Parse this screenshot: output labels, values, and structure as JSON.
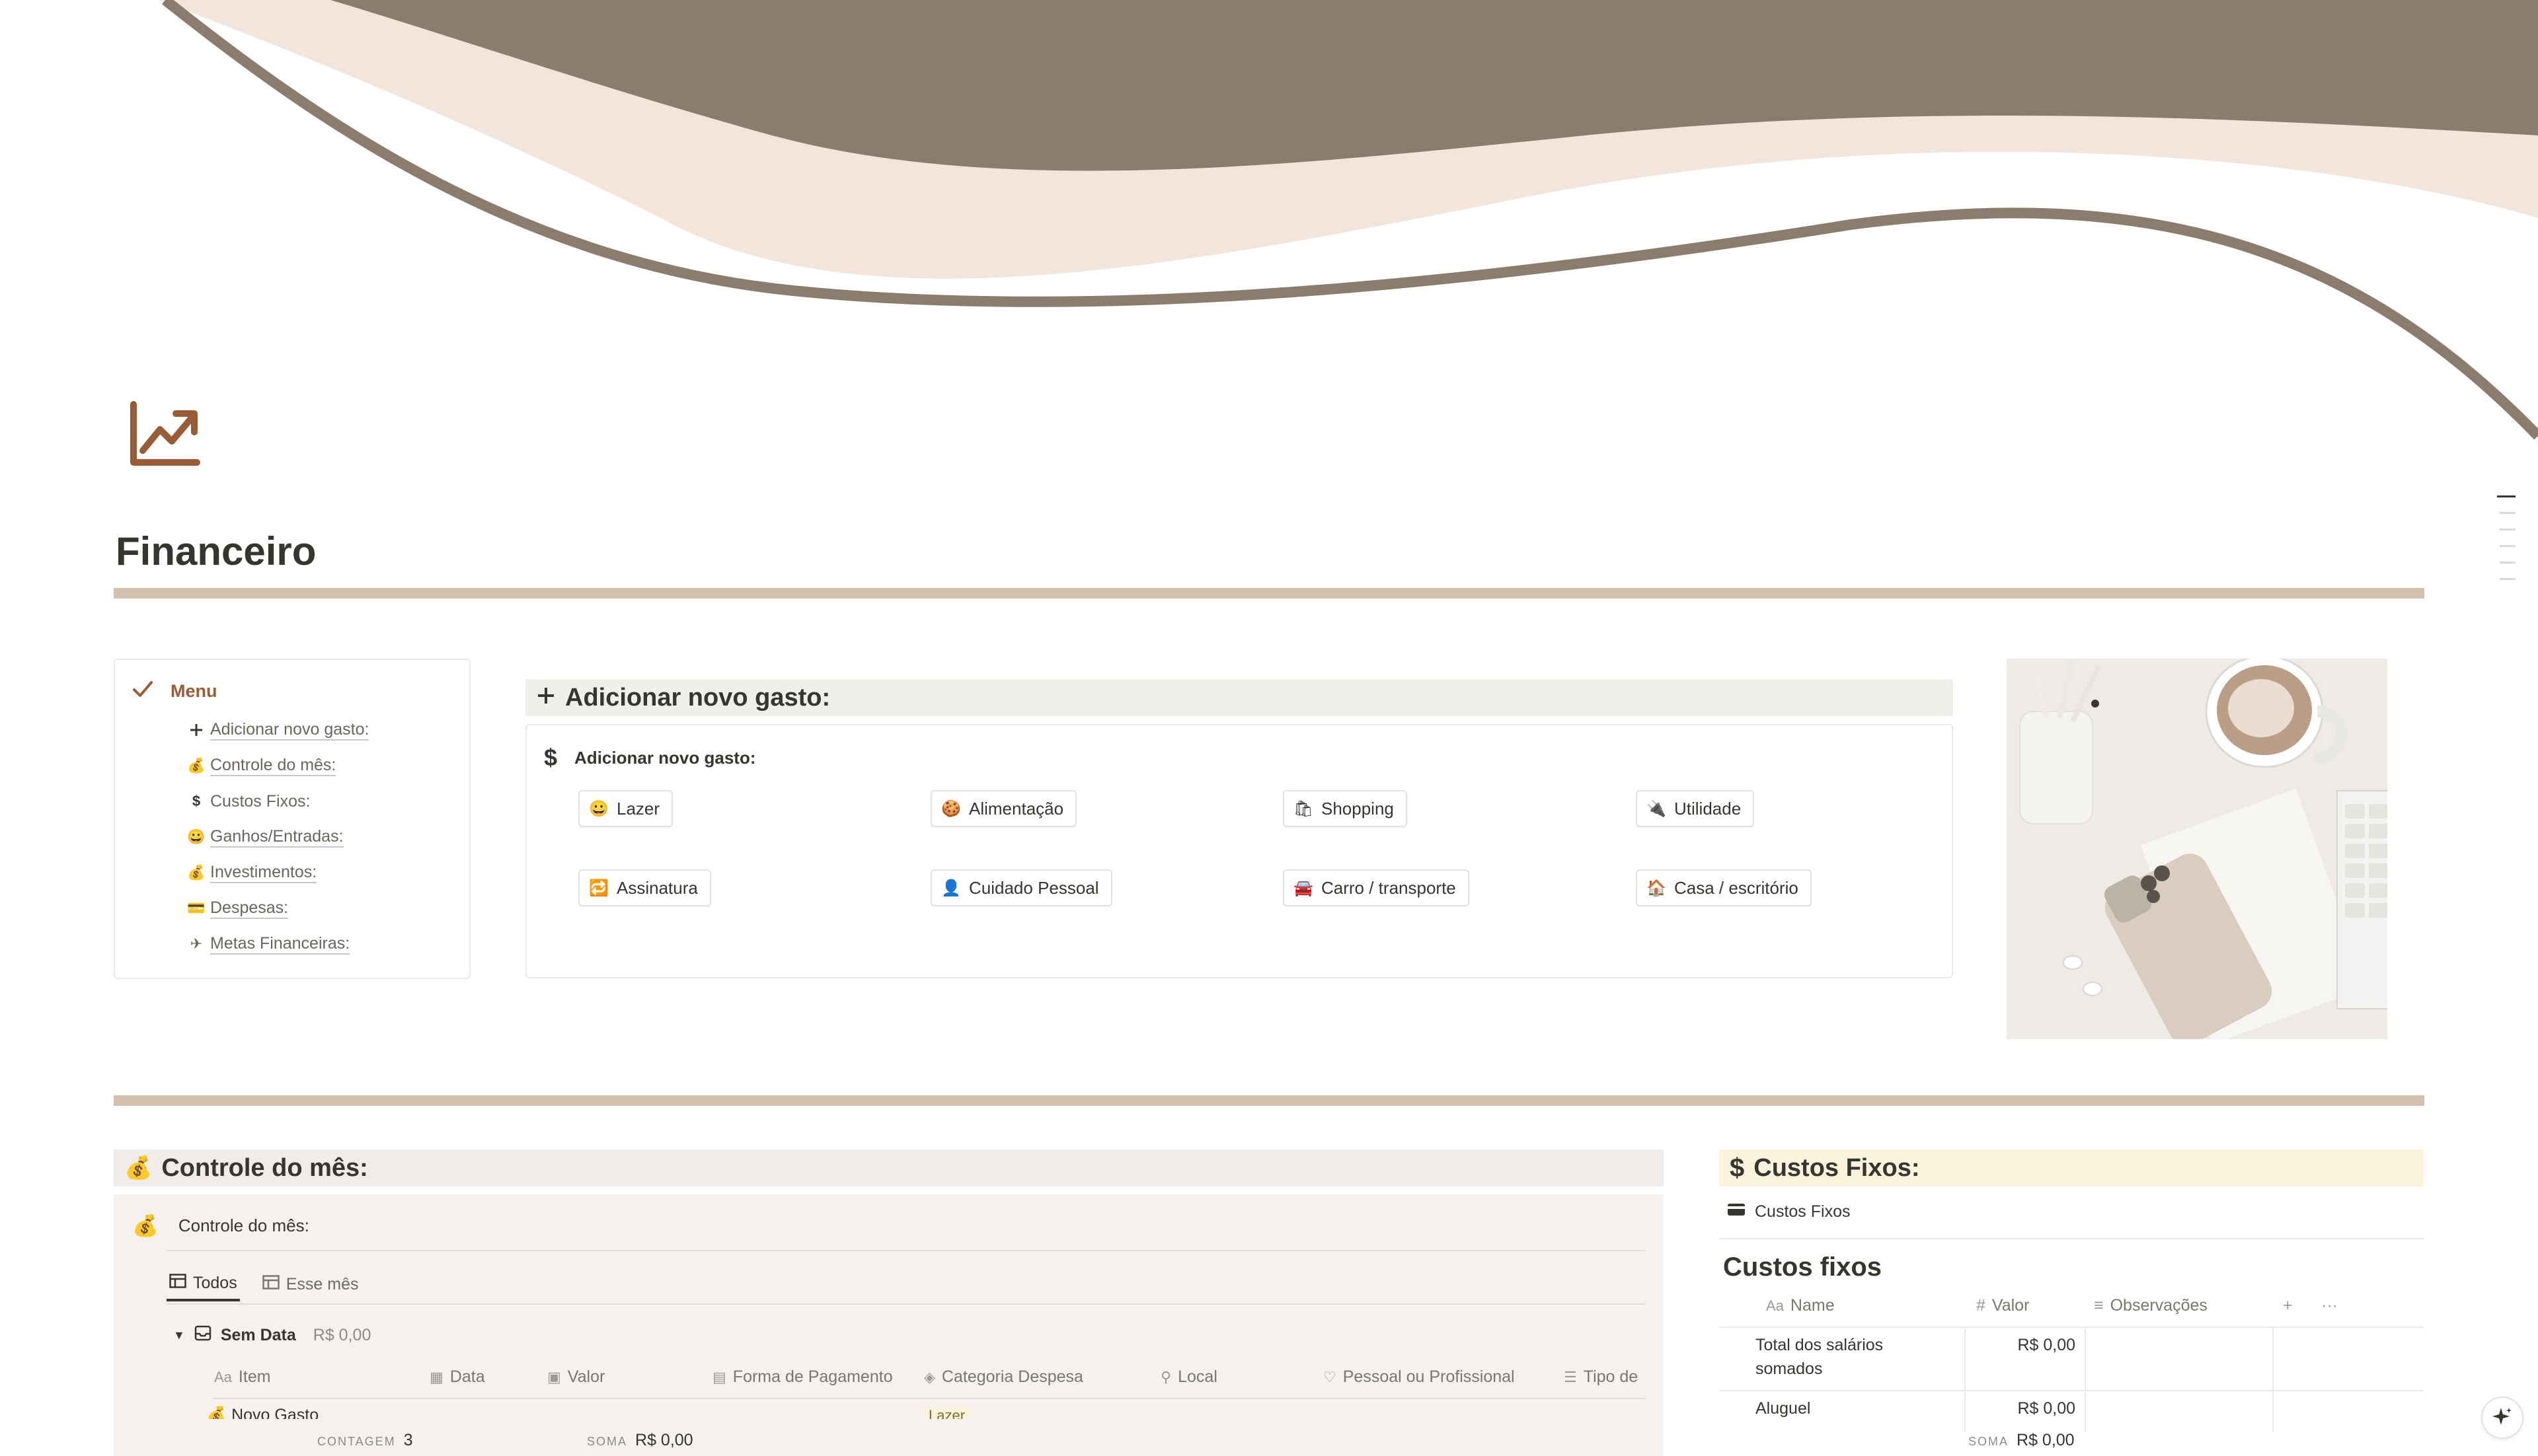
{
  "page": {
    "title": "Financeiro"
  },
  "menu": {
    "heading": "Menu",
    "items": [
      {
        "icon": "plus-icon",
        "label": "Adicionar novo gasto:"
      },
      {
        "icon": "money-bag-icon",
        "label": "Controle do mês:"
      },
      {
        "icon": "dollar-icon",
        "label": "Custos Fixos:"
      },
      {
        "icon": "smile-icon",
        "label": " Ganhos/Entradas:"
      },
      {
        "icon": "money-bag-icon",
        "label": "Investimentos:"
      },
      {
        "icon": "card-icon",
        "label": "Despesas:"
      },
      {
        "icon": "plane-icon",
        "label": "Metas Financeiras:"
      }
    ]
  },
  "add_expense": {
    "heading": "Adicionar novo gasto:",
    "card_title": "Adicionar novo gasto:",
    "buttons": [
      {
        "icon": "smile-icon",
        "label": "Lazer"
      },
      {
        "icon": "food-icon",
        "label": "Alimentação"
      },
      {
        "icon": "shopping-bag-icon",
        "label": "Shopping"
      },
      {
        "icon": "plug-icon",
        "label": "Utilidade"
      },
      {
        "icon": "repeat-icon",
        "label": "Assinatura"
      },
      {
        "icon": "person-icon",
        "label": "Cuidado Pessoal"
      },
      {
        "icon": "car-icon",
        "label": "Carro / transporte"
      },
      {
        "icon": "house-icon",
        "label": "Casa / escritório"
      }
    ]
  },
  "month_control": {
    "heading": "Controle do mês:",
    "db_title": "Controle do mês:",
    "views": [
      "Todos",
      "Esse mês"
    ],
    "group": {
      "name": "Sem Data",
      "amount": "R$ 0,00"
    },
    "columns": [
      "Item",
      "Data",
      "Valor",
      "Forma de Pagamento",
      "Categoria Despesa",
      "Local",
      "Pessoal ou Profissional",
      "Tipo de"
    ],
    "first_row": "Novo Gasto",
    "first_row_tag": "Lazer",
    "count_label": "CONTAGEM",
    "count_value": "3",
    "sum_label": "SOMA",
    "sum_value": "R$ 0,00"
  },
  "fixed_costs": {
    "heading": "Custos Fixos:",
    "db_link": "Custos Fixos",
    "table_title": "Custos fixos",
    "columns": [
      "Name",
      "Valor",
      "Observações"
    ],
    "rows": [
      {
        "name": "Total dos salários somados",
        "value": "R$ 0,00"
      },
      {
        "name": "Aluguel",
        "value": "R$ 0,00"
      }
    ],
    "sum_label": "SOMA",
    "sum_value": "R$ 0,00"
  },
  "colors": {
    "accent_brown": "#9a5c35",
    "rule": "#d3c1ad",
    "cover_dark": "#8b7d6e",
    "cover_light": "#f2e6dc"
  }
}
